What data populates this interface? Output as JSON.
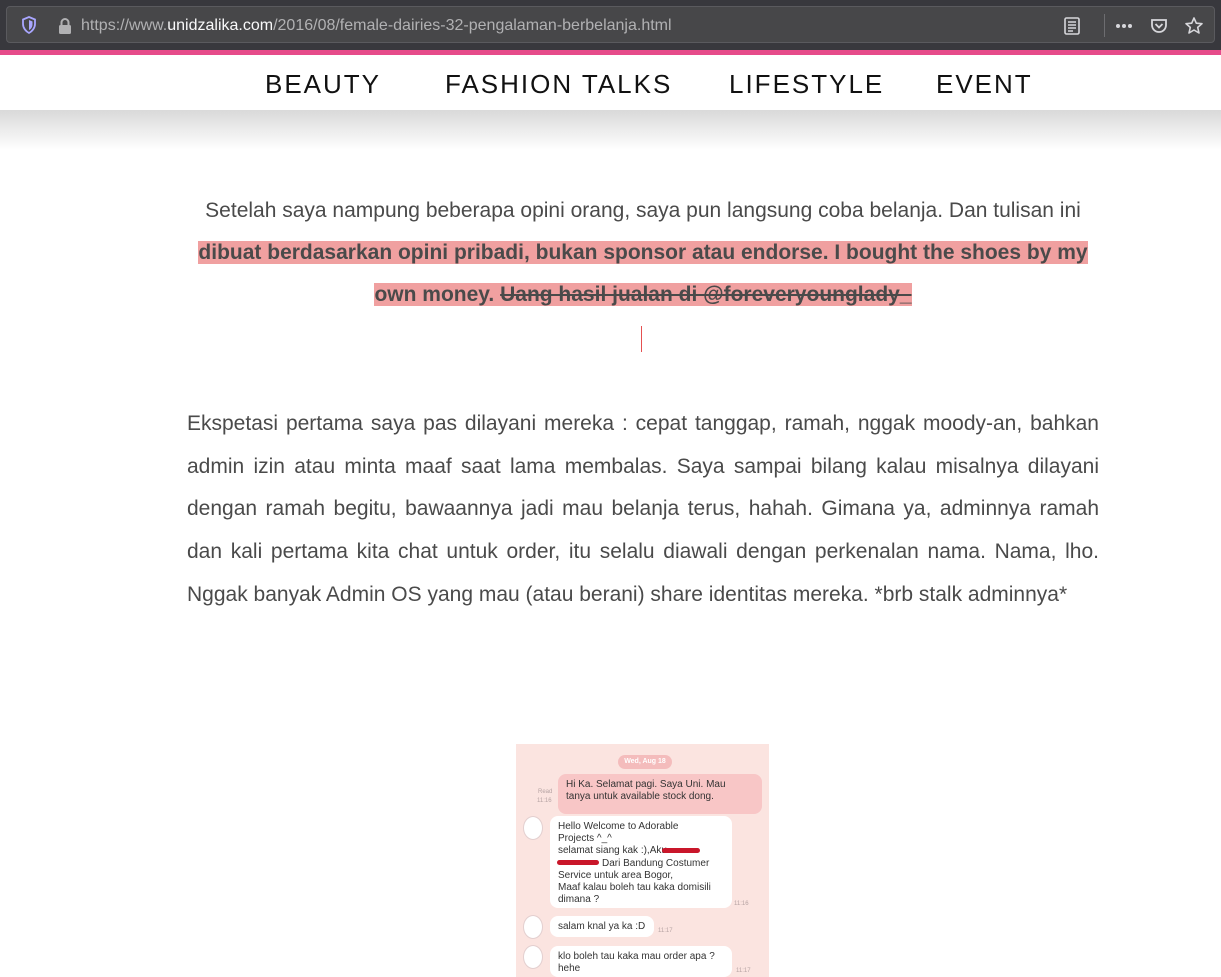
{
  "browser": {
    "url_prefix": "https://www.",
    "url_host": "unidzalika.com",
    "url_path": "/2016/08/female-dairies-32-pengalaman-berbelanja.html",
    "icons": [
      "shield-icon",
      "lock-icon",
      "reader-view-icon",
      "more-actions-icon",
      "pocket-icon",
      "bookmark-star-icon"
    ]
  },
  "colors": {
    "accent": "#e64b8a",
    "highlight": "#f0a0a0",
    "text": "#4a4a4a"
  },
  "nav": {
    "items": [
      "BEAUTY",
      "FASHION TALKS",
      "LIFESTYLE",
      "EVENT"
    ]
  },
  "article": {
    "p1_plain": "Setelah saya nampung beberapa opini orang, saya pun langsung coba belanja. Dan tulisan ini ",
    "p1_highlight": "dibuat berdasarkan opini pribadi, bukan sponsor atau endorse. I bought the shoes by my own money. ",
    "p1_strike": "Uang hasil jualan di @foreveryounglady_",
    "p2": "Ekspetasi pertama saya pas dilayani mereka : cepat tanggap, ramah, nggak moody-an, bahkan admin izin atau minta maaf saat lama membalas. Saya sampai bilang kalau misalnya dilayani dengan ramah begitu, bawaannya jadi mau belanja terus, hahah. Gimana ya, adminnya ramah dan kali pertama kita chat untuk order, itu selalu diawali dengan perkenalan nama. Nama, lho. Nggak banyak Admin OS yang mau (atau berani) share identitas mereka. *brb stalk adminnya*"
  },
  "chat": {
    "date": "Wed, Aug 18",
    "read_label": "Read",
    "messages": [
      {
        "from": "me",
        "lines": [
          "Hi Ka. Selamat pagi. Saya Uni. Mau",
          "tanya untuk available stock dong."
        ],
        "time": "11:16"
      },
      {
        "from": "them",
        "lines": [
          "Hello Welcome to Adorable",
          "Projects ^_^",
          "selamat siang kak :),Aku",
          "Dari Bandung Costumer",
          "Service untuk area Bogor,",
          " Maaf kalau boleh tau kaka domisili",
          "dimana ?"
        ],
        "time": "11:16"
      },
      {
        "from": "them",
        "lines": [
          "salam knal ya ka :D"
        ],
        "time": "11:17"
      },
      {
        "from": "them",
        "lines": [
          "klo boleh tau kaka mau order apa ?",
          "hehe"
        ],
        "time": "11:17"
      }
    ]
  }
}
